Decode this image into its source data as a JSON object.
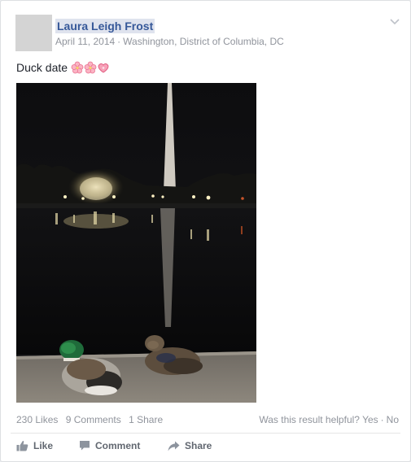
{
  "post": {
    "author": "Laura Leigh Frost",
    "date": "April 11, 2014",
    "separator": "·",
    "location": "Washington, District of Columbia, DC",
    "text": "Duck date",
    "emojis": [
      "cherry-blossom",
      "cherry-blossom",
      "sparkling-heart"
    ]
  },
  "stats": {
    "likes": "230 Likes",
    "comments": "9 Comments",
    "shares": "1 Share"
  },
  "feedback": {
    "question": "Was this result helpful?",
    "yes": "Yes",
    "separator": "·",
    "no": "No"
  },
  "actions": {
    "like": "Like",
    "comment": "Comment",
    "share": "Share"
  },
  "icons": {
    "menu": "chevron-down-icon",
    "like": "thumbs-up-icon",
    "comment": "speech-bubble-icon",
    "share": "share-arrow-icon"
  },
  "colors": {
    "author_link": "#365899",
    "author_highlight": "#dfe3ee",
    "meta_text": "#90949c",
    "action_text": "#616770",
    "emoji_pink": "#f27a9a"
  }
}
